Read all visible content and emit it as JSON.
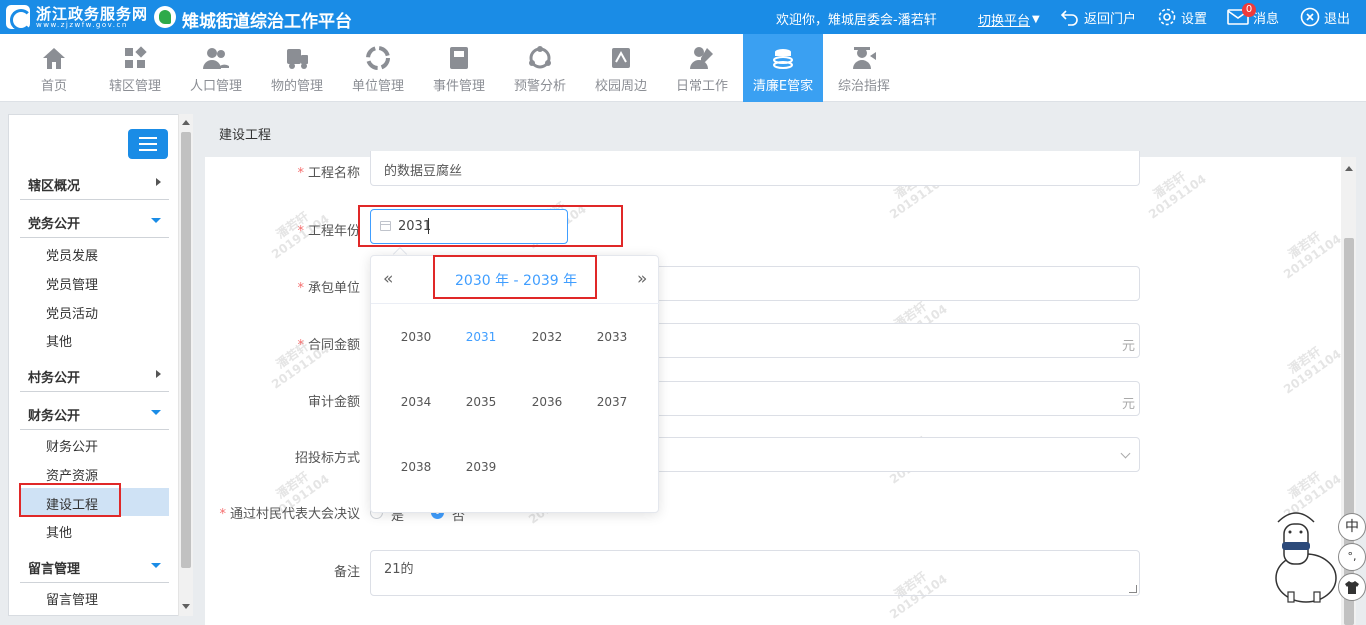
{
  "header": {
    "gov_name": "浙江政务服务网",
    "gov_url": "www.zjzwfw.gov.cn",
    "platform_name": "雉城街道综治工作平台",
    "welcome": "欢迎你，雉城居委会-潘若轩",
    "switch_label": "切换平台",
    "switch_caret": "▼",
    "back_label": "返回门户",
    "settings_label": "设置",
    "message_label": "消息",
    "message_count": "0",
    "logout_label": "退出"
  },
  "nav": {
    "items": [
      {
        "label": "首页",
        "icon": "home-icon"
      },
      {
        "label": "辖区管理",
        "icon": "grid-icon"
      },
      {
        "label": "人口管理",
        "icon": "people-icon"
      },
      {
        "label": "物的管理",
        "icon": "truck-icon"
      },
      {
        "label": "单位管理",
        "icon": "org-icon"
      },
      {
        "label": "事件管理",
        "icon": "book-icon"
      },
      {
        "label": "预警分析",
        "icon": "network-icon"
      },
      {
        "label": "校园周边",
        "icon": "school-icon"
      },
      {
        "label": "日常工作",
        "icon": "pen-user-icon"
      },
      {
        "label": "清廉E管家",
        "icon": "stack-icon"
      },
      {
        "label": "综治指挥",
        "icon": "commander-icon"
      }
    ],
    "active_index": 9,
    "active_color": "#3aa0f2"
  },
  "sidebar": {
    "sections": [
      {
        "label": "辖区概况",
        "expanded": false,
        "items": []
      },
      {
        "label": "党务公开",
        "expanded": true,
        "items": [
          "党员发展",
          "党员管理",
          "党员活动",
          "其他"
        ]
      },
      {
        "label": "村务公开",
        "expanded": false,
        "items": []
      },
      {
        "label": "财务公开",
        "expanded": true,
        "items": [
          "财务公开",
          "资产资源",
          "建设工程",
          "其他"
        ]
      },
      {
        "label": "留言管理",
        "expanded": true,
        "items": [
          "留言管理"
        ]
      }
    ],
    "selected_item": "建设工程"
  },
  "breadcrumb": "建设工程",
  "form": {
    "project_name_label": "工程名称",
    "project_name_value": "的数据豆腐丝",
    "project_year_label": "工程年份",
    "project_year_value": "2031",
    "contractor_label": "承包单位",
    "contract_amount_label": "合同金额",
    "audit_amount_label": "审计金额",
    "currency_unit": "元",
    "bidding_label": "招投标方式",
    "resolution_label": "通过村民代表大会决议",
    "resolution_yes": "是",
    "resolution_no": "否",
    "resolution_selected": "否",
    "remark_label": "备注",
    "remark_value": "21的"
  },
  "year_picker": {
    "prev": "«",
    "next": "»",
    "range": "2030 年 - 2039 年",
    "years": [
      "2030",
      "2031",
      "2032",
      "2033",
      "2034",
      "2035",
      "2036",
      "2037",
      "2038",
      "2039"
    ],
    "current": "2031"
  },
  "watermark": {
    "name": "潘若轩",
    "code": "20191104"
  },
  "widget": {
    "lang": "中",
    "punct": "°,",
    "shirt": "shirt-icon"
  },
  "colors": {
    "primary": "#1a8ce6",
    "highlight": "#e02828",
    "link": "#409eff"
  }
}
